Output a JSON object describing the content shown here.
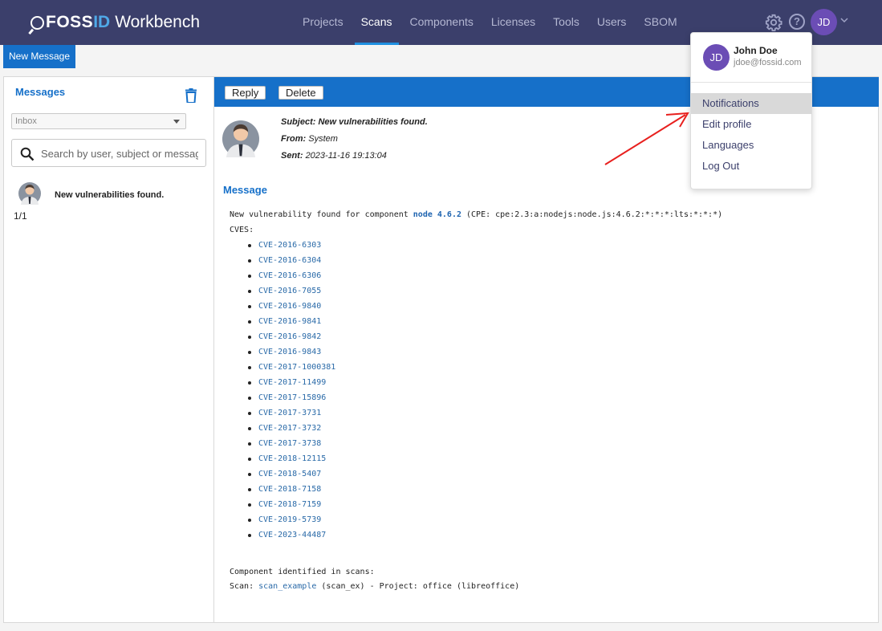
{
  "brand": {
    "fossid": "FOSS",
    "id": "ID",
    "product": "Workbench"
  },
  "nav": [
    {
      "label": "Projects",
      "active": false
    },
    {
      "label": "Scans",
      "active": true
    },
    {
      "label": "Components",
      "active": false
    },
    {
      "label": "Licenses",
      "active": false
    },
    {
      "label": "Tools",
      "active": false
    },
    {
      "label": "Users",
      "active": false
    },
    {
      "label": "SBOM",
      "active": false
    }
  ],
  "user": {
    "initials": "JD",
    "name": "John Doe",
    "email": "jdoe@fossid.com"
  },
  "help_label": "?",
  "new_message_label": "New Message",
  "messages_panel": {
    "title": "Messages",
    "folder": "Inbox",
    "search_placeholder": "Search by user, subject or message",
    "items": [
      {
        "subject": "New vulnerabilities found."
      }
    ],
    "pager": "1/1"
  },
  "actions": {
    "reply": "Reply",
    "delete": "Delete"
  },
  "message": {
    "subject_label": "Subject:",
    "subject": "New vulnerabilities found.",
    "from_label": "From:",
    "from": "System",
    "sent_label": "Sent:",
    "sent": "2023-11-16 19:13:04",
    "section_title": "Message",
    "intro_prefix": "New vulnerability found for component ",
    "component": "node 4.6.2",
    "intro_suffix": " (CPE: cpe:2.3:a:nodejs:node.js:4.6.2:*:*:*:lts:*:*:*)",
    "cves_label": "CVES:",
    "cves": [
      "CVE-2016-6303",
      "CVE-2016-6304",
      "CVE-2016-6306",
      "CVE-2016-7055",
      "CVE-2016-9840",
      "CVE-2016-9841",
      "CVE-2016-9842",
      "CVE-2016-9843",
      "CVE-2017-1000381",
      "CVE-2017-11499",
      "CVE-2017-15896",
      "CVE-2017-3731",
      "CVE-2017-3732",
      "CVE-2017-3738",
      "CVE-2018-12115",
      "CVE-2018-5407",
      "CVE-2018-7158",
      "CVE-2018-7159",
      "CVE-2019-5739",
      "CVE-2023-44487"
    ],
    "identified_label": "Component identified in scans:",
    "scan_prefix": "Scan: ",
    "scan_link": "scan_example",
    "scan_suffix": " (scan_ex) - Project: office (libreoffice)"
  },
  "user_menu": [
    {
      "label": "Notifications",
      "highlighted": true
    },
    {
      "label": "Edit profile",
      "highlighted": false
    },
    {
      "label": "Languages",
      "highlighted": false
    },
    {
      "label": "Log Out",
      "highlighted": false
    }
  ],
  "colors": {
    "topbar": "#3b3f6b",
    "accent": "#1670c9",
    "avatar": "#6b4db5",
    "annotation_arrow": "#e8201e"
  }
}
